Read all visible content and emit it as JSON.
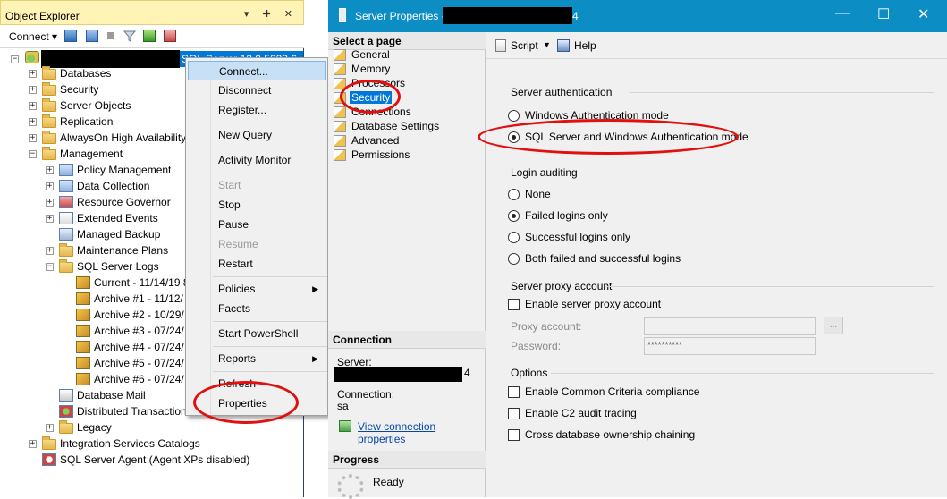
{
  "object_explorer": {
    "title": "Object Explorer",
    "title_buttons": "▾ ✚ ✕",
    "connect_label": "Connect ▾",
    "server_label": "SQL Server 12.0.5223.6 - s",
    "tree": [
      {
        "label": "Databases"
      },
      {
        "label": "Security"
      },
      {
        "label": "Server Objects"
      },
      {
        "label": "Replication"
      },
      {
        "label": "AlwaysOn High Availability"
      },
      {
        "label": "Management"
      },
      {
        "label": "Policy Management"
      },
      {
        "label": "Data Collection"
      },
      {
        "label": "Resource Governor"
      },
      {
        "label": "Extended Events"
      },
      {
        "label": "Managed Backup"
      },
      {
        "label": "Maintenance Plans"
      },
      {
        "label": "SQL Server Logs"
      },
      {
        "label": "Current - 11/14/19 8"
      },
      {
        "label": "Archive #1 - 11/12/"
      },
      {
        "label": "Archive #2 - 10/29/"
      },
      {
        "label": "Archive #3 - 07/24/"
      },
      {
        "label": "Archive #4 - 07/24/"
      },
      {
        "label": "Archive #5 - 07/24/"
      },
      {
        "label": "Archive #6 - 07/24/"
      },
      {
        "label": "Database Mail"
      },
      {
        "label": "Distributed Transaction"
      },
      {
        "label": "Legacy"
      },
      {
        "label": "Integration Services Catalogs"
      },
      {
        "label": "SQL Server Agent (Agent XPs disabled)"
      }
    ]
  },
  "context_menu": {
    "items": [
      "Connect...",
      "Disconnect",
      "Register...",
      "New Query",
      "Activity Monitor",
      "Start",
      "Stop",
      "Pause",
      "Resume",
      "Restart",
      "Policies",
      "Facets",
      "Start PowerShell",
      "Reports",
      "Refresh",
      "Properties"
    ],
    "submenu_arrow": "▶"
  },
  "server_properties": {
    "title": "Server Properties -",
    "title_suffix": "4",
    "window_controls": {
      "min": "—",
      "max": "☐",
      "close": "✕"
    },
    "select_page_header": "Select a page",
    "pages": [
      "General",
      "Memory",
      "Processors",
      "Security",
      "Connections",
      "Database Settings",
      "Advanced",
      "Permissions"
    ],
    "selected_page": "Security",
    "toolbar": {
      "script": "Script",
      "help": "Help"
    },
    "connection": {
      "header": "Connection",
      "server_label": "Server:",
      "server_suffix": "4",
      "connection_label": "Connection:",
      "connection_value": "sa",
      "view_link": "View connection properties"
    },
    "progress": {
      "header": "Progress",
      "status": "Ready"
    },
    "server_auth": {
      "title": "Server authentication",
      "windows_mode": "Windows Authentication mode",
      "mixed_mode": "SQL Server and Windows Authentication mode",
      "selected": "mixed"
    },
    "login_auditing": {
      "title": "Login auditing",
      "options": [
        "None",
        "Failed logins only",
        "Successful logins only",
        "Both failed and successful logins"
      ],
      "selected_index": 1
    },
    "proxy": {
      "title": "Server proxy account",
      "enable_label": "Enable server proxy account",
      "proxy_account_label": "Proxy account:",
      "password_label": "Password:",
      "password_value": "**********",
      "browse_label": "..."
    },
    "options": {
      "title": "Options",
      "items": [
        "Enable Common Criteria compliance",
        "Enable C2 audit tracing",
        "Cross database ownership chaining"
      ]
    }
  },
  "colors": {
    "accent": "#0c8ec4",
    "selection": "#0078d7",
    "annotation": "#e01010"
  }
}
